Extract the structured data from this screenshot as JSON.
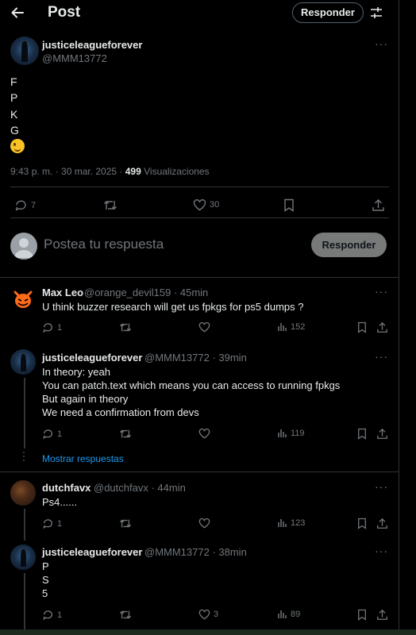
{
  "header": {
    "title": "Post",
    "reply_button": "Responder"
  },
  "main_post": {
    "author_name": "justiceleagueforever",
    "author_handle": "@MMM13772",
    "lines": [
      "F",
      "P",
      "K",
      "G"
    ],
    "timestamp": "9:43 p. m. · 30 mar. 2025 · ",
    "views_count": "499",
    "views_label": " Visualizaciones",
    "replies": "7",
    "likes": "30"
  },
  "composer": {
    "placeholder": "Postea tu respuesta",
    "button": "Responder"
  },
  "replies": [
    {
      "name": "Max Leo",
      "meta": "@orange_devil159 · 45min",
      "lines": [
        "U think buzzer research will get us fpkgs for ps5 dumps ?"
      ],
      "replies": "1",
      "retweets": "",
      "likes": "",
      "views": "152"
    },
    {
      "name": "justiceleagueforever",
      "meta": "@MMM13772 · 39min",
      "lines": [
        "In theory: yeah",
        "You can patch.text which means you can access to running fpkgs",
        "But again in theory",
        "We need a confirmation from devs"
      ],
      "replies": "1",
      "retweets": "",
      "likes": "",
      "views": "119"
    },
    {
      "name": "dutchfavx",
      "meta": "@dutchfavx · 44min",
      "lines": [
        "Ps4......"
      ],
      "replies": "1",
      "retweets": "",
      "likes": "",
      "views": "123"
    },
    {
      "name": "justiceleagueforever",
      "meta": "@MMM13772 · 38min",
      "lines": [
        "P",
        "S",
        "5"
      ],
      "replies": "1",
      "retweets": "",
      "likes": "3",
      "views": "89"
    }
  ],
  "show_replies": "Mostrar respuestas",
  "colors": {
    "background": "#000000",
    "text": "#e7e9ea",
    "muted": "#71767b",
    "link": "#1d9bf0",
    "border": "#2f3336"
  }
}
